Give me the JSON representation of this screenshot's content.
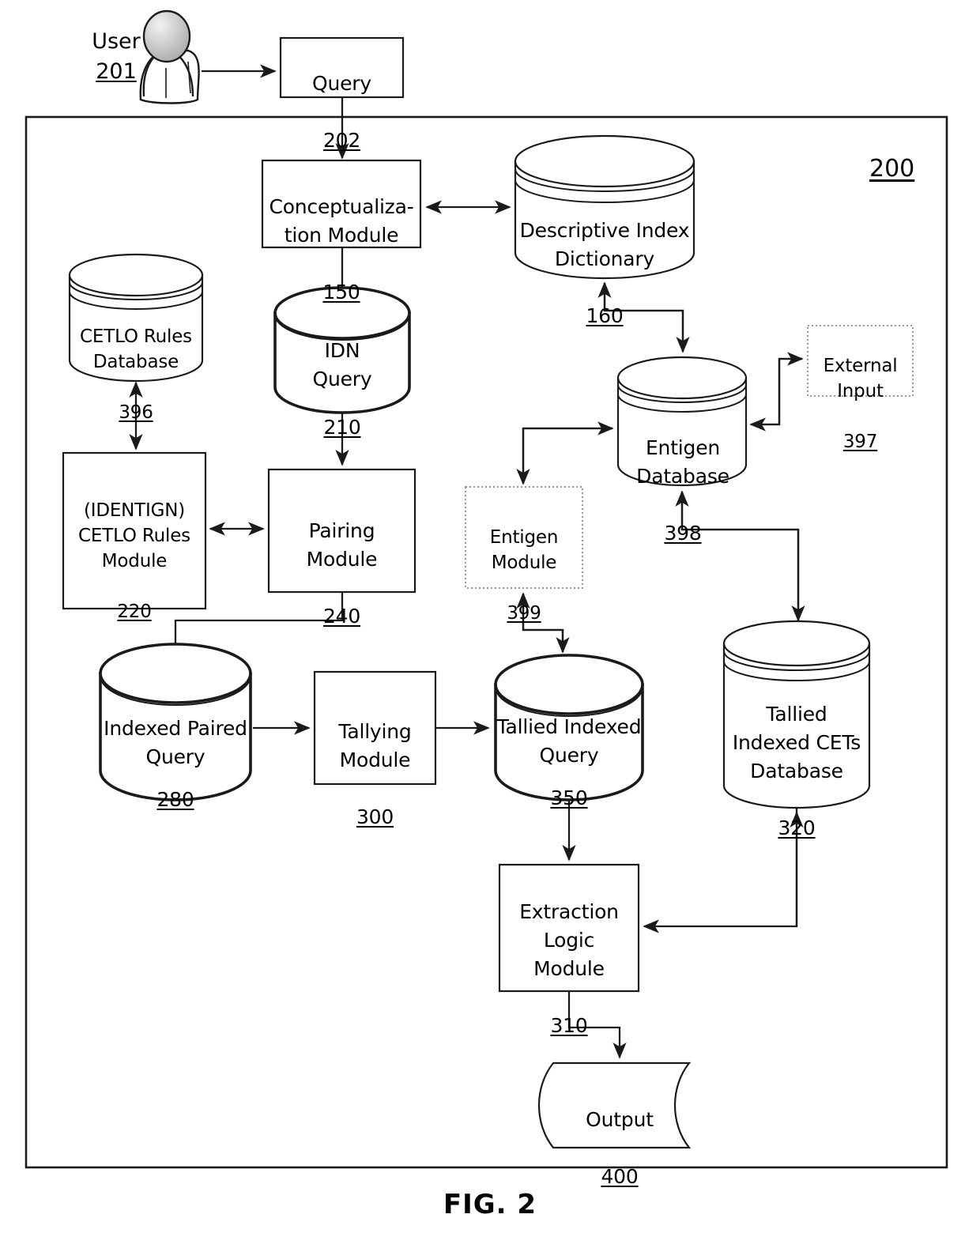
{
  "figure": {
    "caption": "FIG. 2",
    "system_ref": "200"
  },
  "actor": {
    "name": "User",
    "ref": "201",
    "icon": "user-avatar-icon"
  },
  "nodes": [
    {
      "id": "query",
      "label": "Query",
      "ref": "202",
      "shape": "rect"
    },
    {
      "id": "conceptualization",
      "label": "Conceptualiza-\ntion Module",
      "ref": "150",
      "shape": "rect"
    },
    {
      "id": "descriptive_index",
      "label": "Descriptive Index\nDictionary",
      "ref": "160",
      "shape": "cylinder-3line"
    },
    {
      "id": "cetlo_rules_db",
      "label": "CETLO Rules\nDatabase",
      "ref": "396",
      "shape": "cylinder-3line"
    },
    {
      "id": "idn_query",
      "label": "IDN\nQuery",
      "ref": "210",
      "shape": "cylinder-bold"
    },
    {
      "id": "cetlo_rules_module",
      "label": "(IDENTIGN)\nCETLO Rules\nModule",
      "ref": "220",
      "shape": "rect"
    },
    {
      "id": "pairing_module",
      "label": "Pairing\nModule",
      "ref": "240",
      "shape": "rect"
    },
    {
      "id": "entigen_module",
      "label": "Entigen\nModule",
      "ref": "399",
      "shape": "rect-dotted"
    },
    {
      "id": "entigen_db",
      "label": "Entigen\nDatabase",
      "ref": "398",
      "shape": "cylinder-3line"
    },
    {
      "id": "external_input",
      "label": "External\nInput",
      "ref": "397",
      "shape": "rect-dotted"
    },
    {
      "id": "indexed_paired_query",
      "label": "Indexed Paired\nQuery",
      "ref": "280",
      "shape": "cylinder-bold"
    },
    {
      "id": "tallying_module",
      "label": "Tallying\nModule",
      "ref": "300",
      "shape": "rect"
    },
    {
      "id": "tallied_indexed_query",
      "label": "Tallied Indexed\nQuery",
      "ref": "350",
      "shape": "cylinder-bold"
    },
    {
      "id": "tallied_cets_db",
      "label": "Tallied\nIndexed CETs\nDatabase",
      "ref": "320",
      "shape": "cylinder-3line"
    },
    {
      "id": "extraction_logic",
      "label": "Extraction\nLogic\nModule",
      "ref": "310",
      "shape": "rect"
    },
    {
      "id": "output",
      "label": "Output",
      "ref": "400",
      "shape": "document"
    }
  ],
  "colors": {
    "stroke": "#1a1a1a",
    "dotted_stroke": "#8a8a8a",
    "background": "#ffffff"
  }
}
